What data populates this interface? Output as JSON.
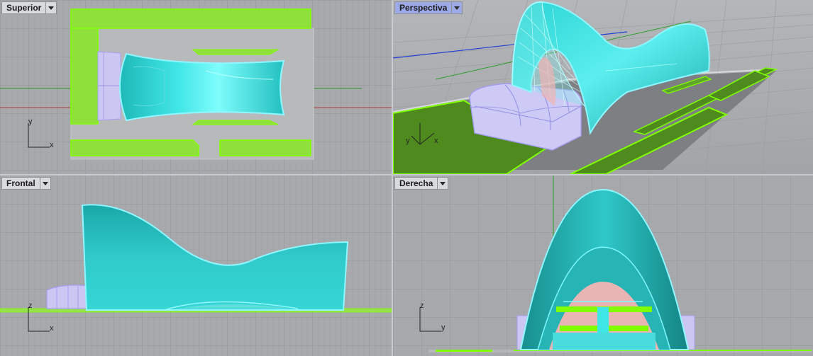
{
  "viewports": [
    {
      "id": "top",
      "label": "Superior",
      "active": false,
      "axis_x": "x",
      "axis_y": "y"
    },
    {
      "id": "perspective",
      "label": "Perspectiva",
      "active": true,
      "axis_x": "x",
      "axis_y": "y"
    },
    {
      "id": "front",
      "label": "Frontal",
      "active": false,
      "axis_x": "x",
      "axis_y": "z"
    },
    {
      "id": "right",
      "label": "Derecha",
      "active": false,
      "axis_x": "y",
      "axis_y": "z"
    }
  ],
  "icons": {
    "viewport_menu": "chevron-down-icon"
  },
  "colors": {
    "viewport_bg": "#a7a9ac",
    "grid_minor": "#9a9ca0",
    "grid_major": "#8d8f93",
    "selection_green": "#7fff00",
    "surface_cyan": "#26c6c6",
    "surface_edge": "#7ff7ff",
    "glass_lavender": "#c8c4f0",
    "axis_x": "#c0392b",
    "axis_y": "#2e9e2e",
    "axis_z": "#1f3fd6",
    "active_tab": "#9ea9e8"
  }
}
